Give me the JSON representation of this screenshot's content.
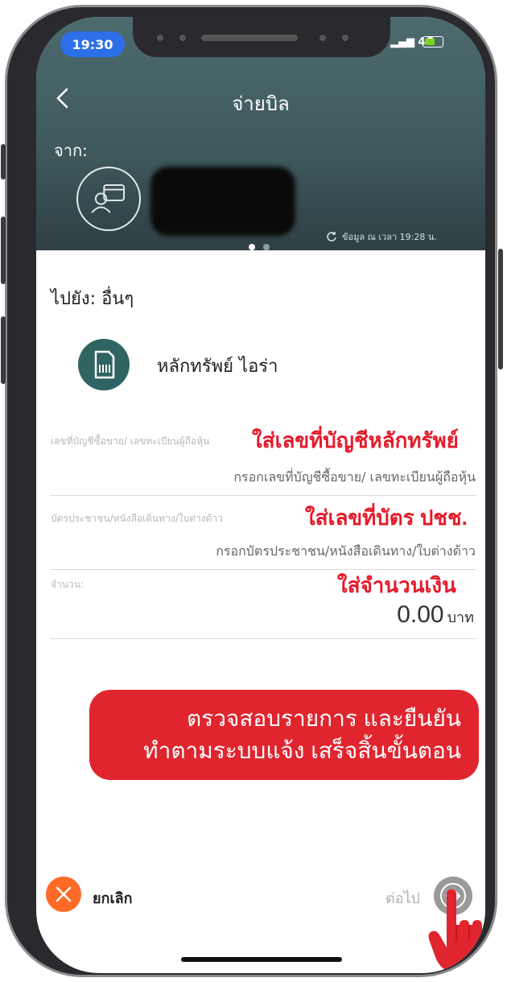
{
  "status": {
    "time": "19:30",
    "network": "4G"
  },
  "header": {
    "title": "จ่ายบิล",
    "from_label": "จาก:",
    "updated_text": "ข้อมูล ณ เวลา 19:28 น."
  },
  "to": {
    "label": "ไปยัง: อื่นๆ",
    "biller_name": "หลักทรัพย์ ไอร่า"
  },
  "fields": [
    {
      "label": "เลขที่บัญชีซื้อขาย/ เลขทะเบียนผู้ถือหุ้น",
      "placeholder": "กรอกเลขที่บัญชีซื้อขาย/ เลขทะเบียนผู้ถือหุ้น",
      "annotation": "ใส่เลขที่บัญชีหลักทรัพย์"
    },
    {
      "label": "บัตรประชาชน/หนังสือเดินทาง/ใบต่างด้าว",
      "placeholder": "กรอกบัตรประชาชน/หนังสือเดินทาง/ใบต่างด้าว",
      "annotation": "ใส่เลขที่บัตร ปชช."
    },
    {
      "label": "จำนวน:",
      "value": "0.00",
      "unit": "บาท",
      "annotation": "ใส่จำนวนเงิน"
    }
  ],
  "callout": {
    "line1": "ตรวจสอบรายการ และยืนยัน",
    "line2": "ทำตามระบบแจ้ง เสร็จสิ้นขั้นตอน"
  },
  "footer": {
    "cancel_label": "ยกเลิก",
    "next_label": "ต่อไป"
  },
  "colors": {
    "accent": "#e1252f",
    "header": "#4c6b6e",
    "cancel": "#ff6a26",
    "biller": "#2f6462"
  }
}
